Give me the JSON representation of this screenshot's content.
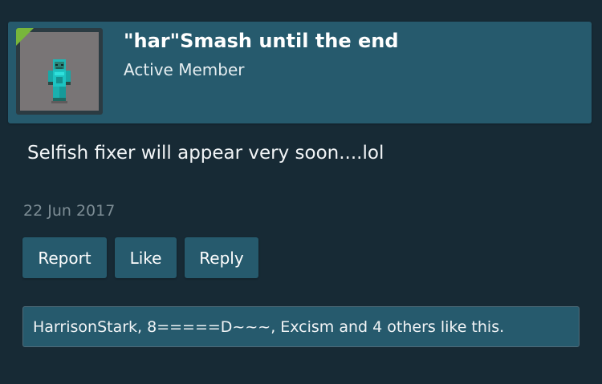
{
  "post": {
    "username": "\"har\"Smash until the end",
    "user_title": "Active Member",
    "message": "Selfish fixer will appear very soon....lol",
    "date": "22 Jun 2017"
  },
  "actions": {
    "report_label": "Report",
    "like_label": "Like",
    "reply_label": "Reply"
  },
  "likes": {
    "summary": "HarrisonStark, 8=====D~~~, Excism and 4 others like this."
  },
  "avatar": {
    "icon": "minecraft-skin-avatar",
    "online": true
  },
  "colors": {
    "background": "#172a35",
    "panel": "#265a6d",
    "online_indicator": "#78b63b",
    "date_text": "#7d8d95"
  }
}
